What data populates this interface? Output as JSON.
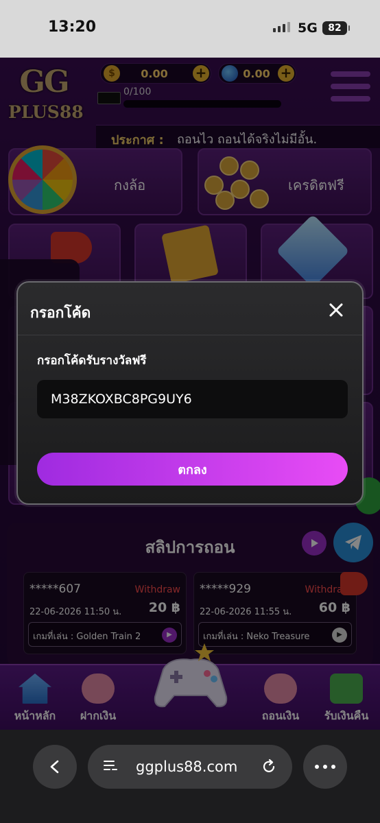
{
  "status_bar": {
    "time": "13:20",
    "network": "5G",
    "battery": "82"
  },
  "header": {
    "logo_top": "GG",
    "logo_bottom": "PLUS88",
    "coin_balance": "0.00",
    "gem_balance": "0.00",
    "level_progress": "0/100"
  },
  "notice": {
    "label": "ประกาศ :",
    "text": "ถอนไว ถอนได้จริงไม่มีอั้น."
  },
  "menu_cards": {
    "wheel_label": "กงล้อ",
    "free_credit_label": "เครดิตฟรี"
  },
  "modal": {
    "title": "กรอกโค้ด",
    "subtitle": "กรอกโค้ดรับรางวัลฟรี",
    "code_value": "M38ZKOXBC8PG9UY6",
    "ok_label": "ตกลง"
  },
  "withdraw_slips": {
    "title": "สลิปการถอน",
    "items": [
      {
        "user": "*****607",
        "type": "Withdraw",
        "date": "22-06-2026 11:50 น.",
        "amount": "20 ฿",
        "game": "เกมที่เล่น : Golden Train 2"
      },
      {
        "user": "*****929",
        "type": "Withdraw",
        "date": "22-06-2026 11:55 น.",
        "amount": "60 ฿",
        "game": "เกมที่เล่น : Neko Treasure"
      }
    ]
  },
  "bottom_nav": {
    "home": "หน้าหลัก",
    "deposit": "ฝากเงิน",
    "withdraw": "ถอนเงิน",
    "cashback": "รับเงินคืน"
  },
  "browser": {
    "url": "ggplus88.com"
  },
  "colors": {
    "accent": "#c64bf0",
    "gold": "#f3cf69",
    "withdraw_red": "#ff4d4d"
  }
}
